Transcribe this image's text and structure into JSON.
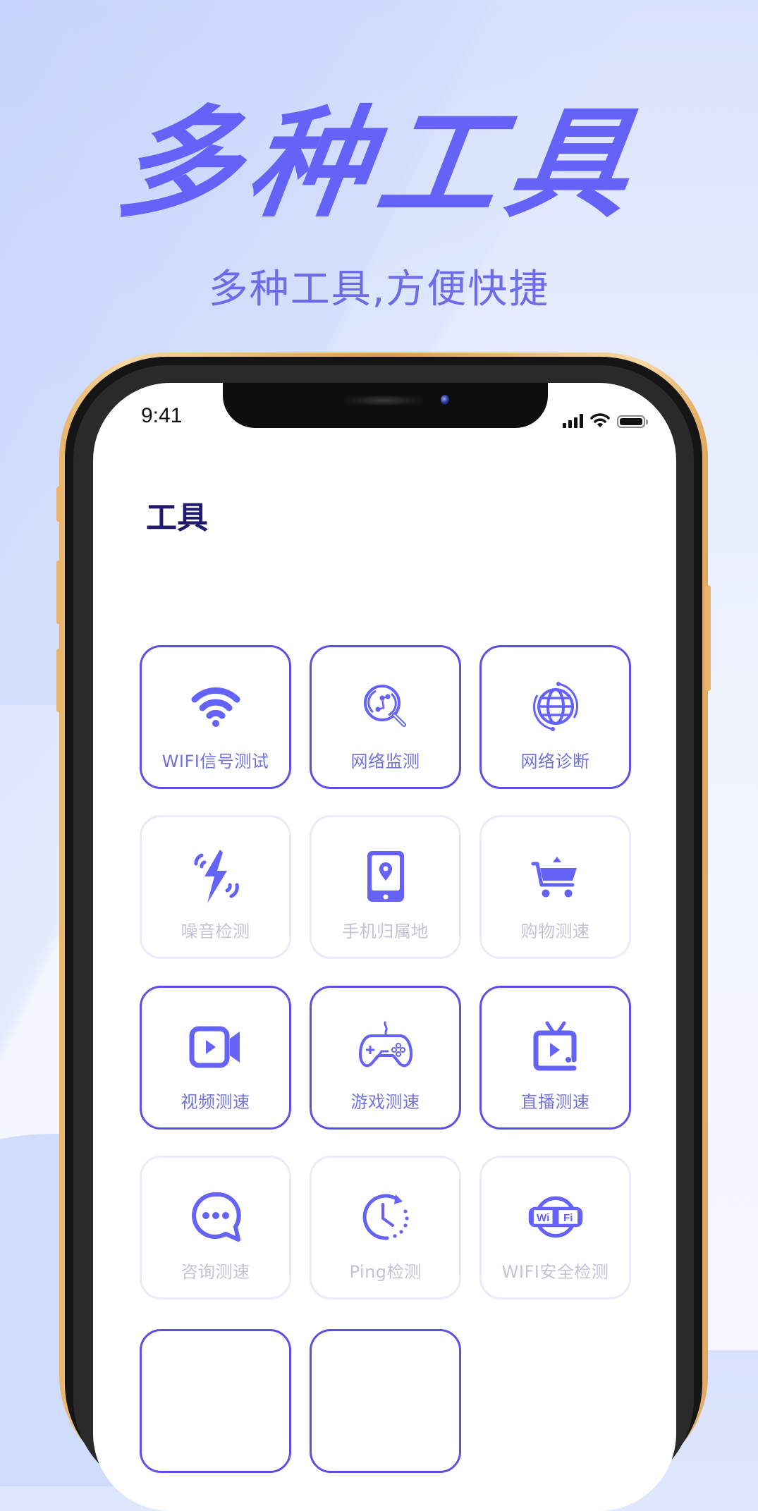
{
  "promo": {
    "headline": "多种工具",
    "subtitle": "多种工具,方便快捷"
  },
  "colors": {
    "accent": "#6462f7",
    "tile_border_active": "#5b4fe6",
    "tile_border_inactive": "#ebe9fb",
    "label_active": "#7372d9",
    "label_inactive": "#c3c3d8",
    "title_dark": "#1f1a6b"
  },
  "status_bar": {
    "time": "9:41",
    "icons": [
      "cellular-signal-icon",
      "wifi-icon",
      "battery-icon"
    ]
  },
  "screen": {
    "title": "工具",
    "tools": [
      {
        "label": "WIFI信号测试",
        "icon": "wifi-signal-icon",
        "style": "active"
      },
      {
        "label": "网络监测",
        "icon": "network-search-icon",
        "style": "active"
      },
      {
        "label": "网络诊断",
        "icon": "globe-refresh-icon",
        "style": "active"
      },
      {
        "label": "噪音检测",
        "icon": "noise-lightning-icon",
        "style": "inactive"
      },
      {
        "label": "手机归属地",
        "icon": "phone-location-icon",
        "style": "inactive"
      },
      {
        "label": "购物测速",
        "icon": "shopping-cart-icon",
        "style": "inactive"
      },
      {
        "label": "视频测速",
        "icon": "video-camera-icon",
        "style": "active"
      },
      {
        "label": "游戏测速",
        "icon": "gamepad-icon",
        "style": "active"
      },
      {
        "label": "直播测速",
        "icon": "tv-live-icon",
        "style": "active"
      },
      {
        "label": "咨询测速",
        "icon": "chat-bubble-icon",
        "style": "inactive"
      },
      {
        "label": "Ping检测",
        "icon": "clock-refresh-icon",
        "style": "inactive"
      },
      {
        "label": "WIFI安全检测",
        "icon": "wifi-badge-icon",
        "style": "inactive"
      },
      {
        "label": "",
        "icon": "",
        "style": "active"
      },
      {
        "label": "",
        "icon": "",
        "style": "active"
      }
    ]
  }
}
